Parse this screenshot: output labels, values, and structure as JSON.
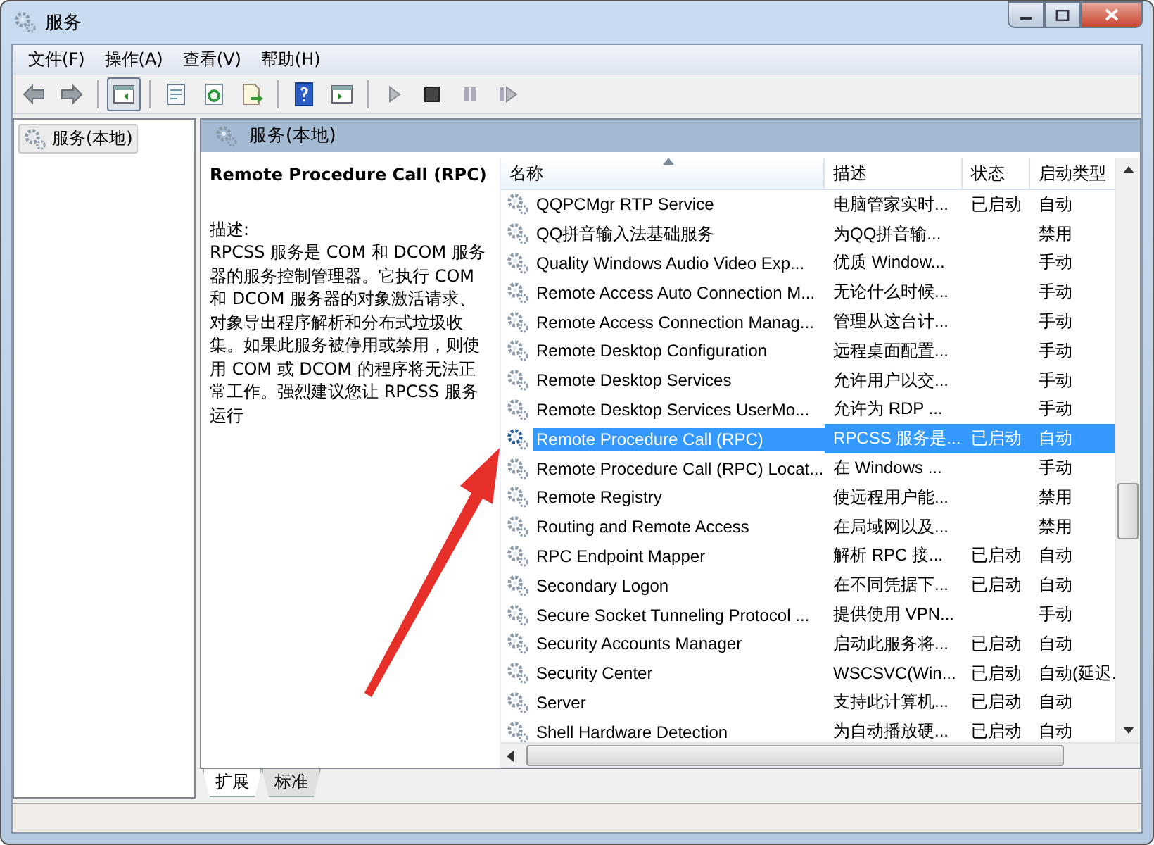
{
  "window": {
    "title": "服务"
  },
  "menu": [
    "文件(F)",
    "操作(A)",
    "查看(V)",
    "帮助(H)"
  ],
  "toolbar": [
    {
      "kind": "back"
    },
    {
      "kind": "forward"
    },
    {
      "kind": "sep"
    },
    {
      "kind": "tree",
      "pressed": true
    },
    {
      "kind": "sep"
    },
    {
      "kind": "properties",
      "pressed": false
    },
    {
      "kind": "refresh",
      "pressed": false
    },
    {
      "kind": "export",
      "pressed": false
    },
    {
      "kind": "sep"
    },
    {
      "kind": "help",
      "pressed": false
    },
    {
      "kind": "view",
      "pressed": false
    },
    {
      "kind": "sep"
    },
    {
      "kind": "play",
      "pressed": false
    },
    {
      "kind": "stop",
      "pressed": false
    },
    {
      "kind": "pause",
      "pressed": false
    },
    {
      "kind": "resume",
      "pressed": false
    }
  ],
  "tree": {
    "items": [
      {
        "label": "服务(本地)",
        "selected": true
      }
    ]
  },
  "panel": {
    "title": "服务(本地)"
  },
  "description": {
    "service": "Remote Procedure Call (RPC)",
    "label": "描述:",
    "text": "RPCSS 服务是 COM 和 DCOM 服务器的服务控制管理器。它执行 COM 和 DCOM 服务器的对象激活请求、对象导出程序解析和分布式垃圾收集。如果此服务被停用或禁用，则使用 COM 或 DCOM 的程序将无法正常工作。强烈建议您让 RPCSS 服务运行"
  },
  "table": {
    "columns": [
      "名称",
      "描述",
      "状态",
      "启动类型"
    ],
    "rows": [
      {
        "name": "QQPCMgr RTP Service",
        "description": "电脑管家实时...",
        "status": "已启动",
        "startup": "自动",
        "selected": false
      },
      {
        "name": "QQ拼音输入法基础服务",
        "description": "为QQ拼音输...",
        "startup": "禁用",
        "selected": false
      },
      {
        "name": "Quality Windows Audio Video Exp...",
        "description": "优质 Window...",
        "startup": "手动",
        "selected": false
      },
      {
        "name": "Remote Access Auto Connection M...",
        "description": "无论什么时候...",
        "startup": "手动",
        "selected": false
      },
      {
        "name": "Remote Access Connection Manag...",
        "description": "管理从这台计...",
        "startup": "手动",
        "selected": false
      },
      {
        "name": "Remote Desktop Configuration",
        "description": "远程桌面配置...",
        "startup": "手动",
        "selected": false
      },
      {
        "name": "Remote Desktop Services",
        "description": "允许用户以交...",
        "startup": "手动",
        "selected": false
      },
      {
        "name": "Remote Desktop Services UserMo...",
        "description": "允许为 RDP ...",
        "startup": "手动",
        "selected": false
      },
      {
        "name": "Remote Procedure Call (RPC)",
        "description": "RPCSS 服务是...",
        "status": "已启动",
        "startup": "自动",
        "selected": true
      },
      {
        "name": "Remote Procedure Call (RPC) Locat...",
        "description": "在 Windows ...",
        "startup": "手动",
        "selected": false
      },
      {
        "name": "Remote Registry",
        "description": "使远程用户能...",
        "startup": "禁用",
        "selected": false
      },
      {
        "name": "Routing and Remote Access",
        "description": "在局域网以及...",
        "startup": "禁用",
        "selected": false
      },
      {
        "name": "RPC Endpoint Mapper",
        "description": "解析 RPC 接...",
        "status": "已启动",
        "startup": "自动",
        "selected": false
      },
      {
        "name": "Secondary Logon",
        "description": "在不同凭据下...",
        "status": "已启动",
        "startup": "自动",
        "selected": false
      },
      {
        "name": "Secure Socket Tunneling Protocol ...",
        "description": "提供使用 VPN...",
        "startup": "手动",
        "selected": false
      },
      {
        "name": "Security Accounts Manager",
        "description": "启动此服务将...",
        "status": "已启动",
        "startup": "自动",
        "selected": false
      },
      {
        "name": "Security Center",
        "description": "WSCSVC(Win...",
        "status": "已启动",
        "startup": "自动(延迟.",
        "selected": false
      },
      {
        "name": "Server",
        "description": "支持此计算机...",
        "status": "已启动",
        "startup": "自动",
        "selected": false
      },
      {
        "name": "Shell Hardware Detection",
        "description": "为自动播放硬...",
        "status": "已启动",
        "startup": "自动",
        "selected": false
      }
    ]
  },
  "tabs": [
    {
      "label": "扩展",
      "selected": true
    },
    {
      "label": "标准",
      "selected": false
    }
  ]
}
